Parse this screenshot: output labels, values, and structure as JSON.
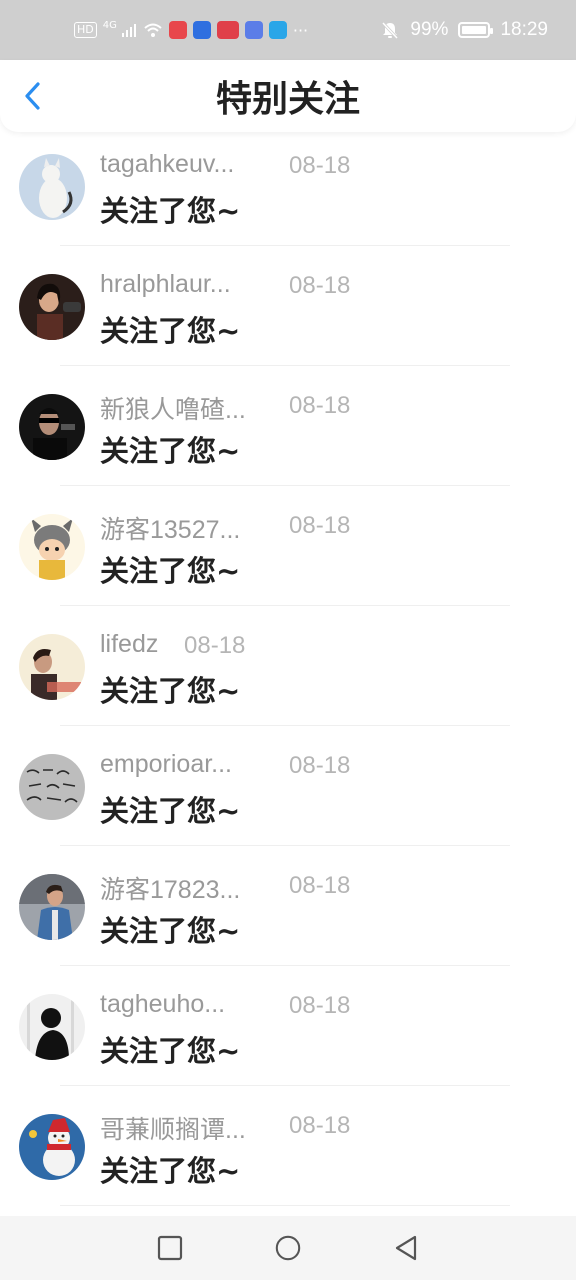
{
  "status_bar": {
    "hd": "HD",
    "signal": "4G",
    "battery_text": "99%",
    "battery_level": 0.99,
    "time": "18:29",
    "more": "···"
  },
  "header": {
    "title": "特别关注"
  },
  "colors": {
    "accent": "#2b8ef0",
    "status_bar": "#cfcfcf"
  },
  "items": [
    {
      "nick": "tagahkeuv...",
      "date": "08-18",
      "message": "关注了您~",
      "avatar": "cat-avatar"
    },
    {
      "nick": "hralphlaur...",
      "date": "08-18",
      "message": "关注了您~",
      "avatar": "woman-avatar"
    },
    {
      "nick": "新狼人噜碴...",
      "date": "08-18",
      "message": "关注了您~",
      "avatar": "gunman-avatar"
    },
    {
      "nick": "游客13527...",
      "date": "08-18",
      "message": "关注了您~",
      "avatar": "cartoon-avatar"
    },
    {
      "nick": "lifedz",
      "date": "08-18",
      "message": "关注了您~",
      "avatar": "man-avatar"
    },
    {
      "nick": "emporioar...",
      "date": "08-18",
      "message": "关注了您~",
      "avatar": "handwriting-avatar"
    },
    {
      "nick": "游客17823...",
      "date": "08-18",
      "message": "关注了您~",
      "avatar": "man-jacket-avatar"
    },
    {
      "nick": "tagheuho...",
      "date": "08-18",
      "message": "关注了您~",
      "avatar": "silhouette-avatar"
    },
    {
      "nick": "哥蒹顺搁谭...",
      "date": "08-18",
      "message": "关注了您~",
      "avatar": "snowman-avatar"
    }
  ]
}
